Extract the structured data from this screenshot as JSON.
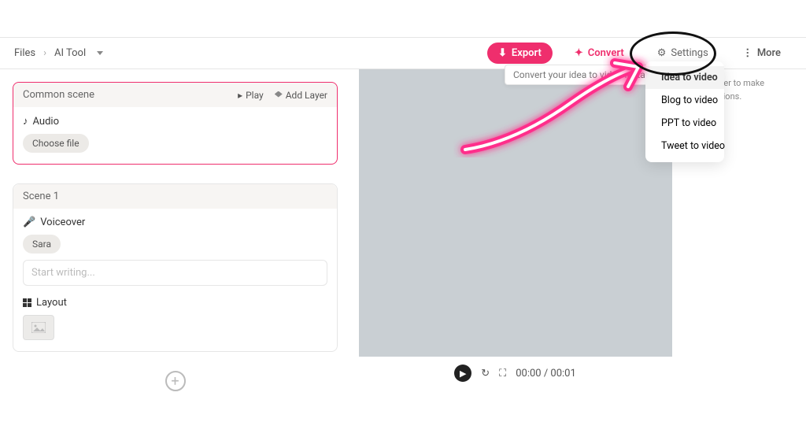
{
  "breadcrumb": {
    "root": "Files",
    "current": "AI Tool"
  },
  "toolbar": {
    "export_label": "Export",
    "convert_label": "Convert",
    "settings_label": "Settings",
    "more_label": "More"
  },
  "tooltip_text": "Convert your idea to video instantly.",
  "convert_menu": [
    {
      "label": "Idea to video",
      "selected": true,
      "color": "#f08c3a"
    },
    {
      "label": "Blog to video",
      "selected": false,
      "color": "#8e4fe0"
    },
    {
      "label": "PPT to video",
      "selected": false,
      "color": "#5cab3d"
    },
    {
      "label": "Tweet to video",
      "selected": false,
      "color": "#1da1f2"
    }
  ],
  "common_scene": {
    "title": "Common scene",
    "play_label": "Play",
    "add_layer_label": "Add Layer",
    "audio_label": "Audio",
    "choose_file_label": "Choose file"
  },
  "scene1": {
    "title": "Scene 1",
    "voiceover_label": "Voiceover",
    "voice_chip": "Sara",
    "placeholder": "Start writing...",
    "layout_label": "Layout"
  },
  "player": {
    "time": "00:00 / 00:01"
  },
  "right_hint": "Select a layer to make customizations."
}
